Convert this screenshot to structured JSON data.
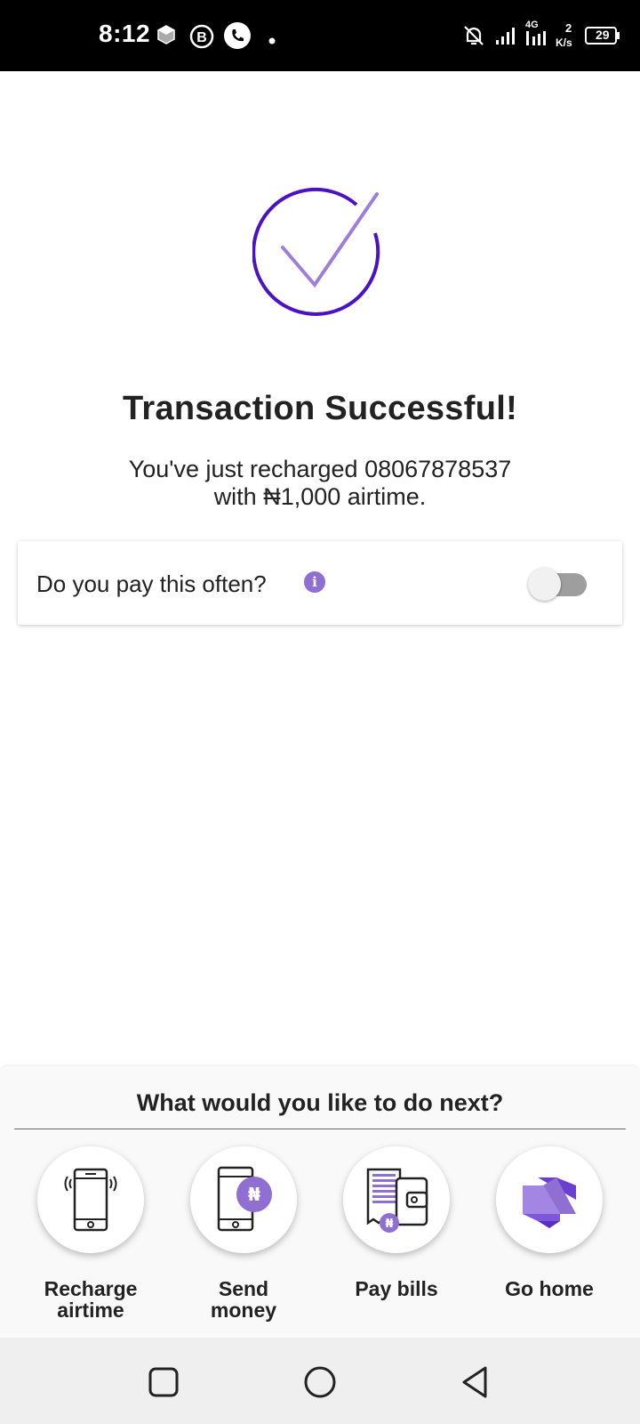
{
  "status_bar": {
    "time": "8:12",
    "network_type": "4G",
    "speed_value": "2",
    "speed_unit": "K/s",
    "battery": "29",
    "icons": [
      "app-cube-icon",
      "whatsapp-business-icon",
      "phone-call-icon",
      "notification-dot-icon",
      "mute-bell-icon",
      "signal-bars-icon",
      "signal-bars-icon",
      "battery-icon"
    ]
  },
  "result": {
    "icon": "check-circle-icon",
    "title": "Transaction Successful!",
    "message_line1": "You've just recharged 08067878537",
    "message_line2": "with ₦1,000 airtime."
  },
  "recurring": {
    "label": "Do you pay this often?",
    "info_glyph": "i",
    "toggle_on": false
  },
  "next_actions": {
    "title": "What would you like to do next?",
    "items": [
      {
        "label_line1": "Recharge",
        "label_line2": "airtime",
        "icon": "phone-airtime-icon"
      },
      {
        "label_line1": "Send",
        "label_line2": "money",
        "icon": "phone-naira-icon"
      },
      {
        "label_line1": "Pay bills",
        "label_line2": "",
        "icon": "bill-wallet-icon"
      },
      {
        "label_line1": "Go home",
        "label_line2": "",
        "icon": "app-logo-icon"
      }
    ]
  },
  "colors": {
    "accent": "#4b12c4",
    "accent_light": "#9b7fd9",
    "toggle_off": "#9e9e9e"
  }
}
